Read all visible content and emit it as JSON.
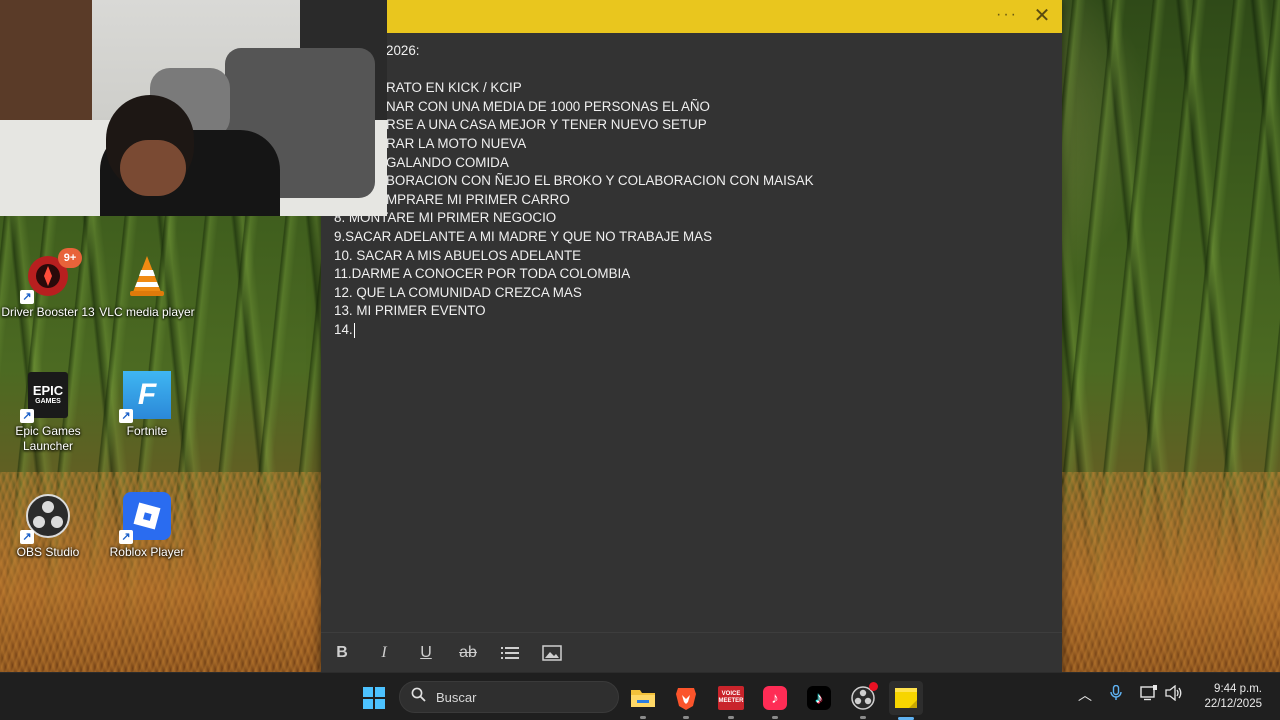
{
  "note": {
    "lines": [
      "2026:",
      "",
      "RATO EN KICK / KCIP",
      "NAR CON UNA MEDIA DE 1000 PERSONAS EL AÑO",
      "RSE A UNA CASA MEJOR Y TENER NUEVO SETUP",
      "RAR LA MOTO NUEVA",
      "GALANDO COMIDA",
      "BORACION CON ÑEJO EL BROKO Y COLABORACION CON MAISAK",
      "MPRARE MI PRIMER CARRO",
      "8. MONTARE MI PRIMER NEGOCIO",
      "9.SACAR ADELANTE A MI MADRE Y QUE NO TRABAJE MAS",
      "10. SACAR A MIS ABUELOS ADELANTE",
      "11.DARME A CONOCER POR TODA COLOMBIA",
      "12. QUE LA COMUNIDAD CREZCA MAS",
      "13. MI PRIMER EVENTO",
      "14."
    ],
    "more_icon": "ellipsis-icon",
    "close_icon": "close-icon",
    "accent_color": "#e9c61e",
    "toolbar": {
      "bold": "B",
      "italic": "I",
      "underline": "U",
      "strikethrough": "ab",
      "bullets_icon": "list-icon",
      "image_icon": "image-icon"
    }
  },
  "desktop_icons": [
    {
      "label": "Driver Booster 13",
      "badge": "9+"
    },
    {
      "label": "VLC media player"
    },
    {
      "label": "Epic Games Launcher",
      "logo_top": "EPIC",
      "logo_bottom": "GAMES"
    },
    {
      "label": "Fortnite",
      "logo": "F"
    },
    {
      "label": "OBS Studio"
    },
    {
      "label": "Roblox Player"
    }
  ],
  "taskbar": {
    "search_placeholder": "Buscar",
    "apps": [
      "start",
      "file-explorer",
      "brave",
      "voicemeeter",
      "tiktok-live",
      "tiktok",
      "obs",
      "sticky-notes"
    ],
    "voicemeeter_label_top": "VOICE",
    "voicemeeter_label_bottom": "MEETER",
    "time": "9:44 p.m.",
    "date": "22/12/2025"
  }
}
